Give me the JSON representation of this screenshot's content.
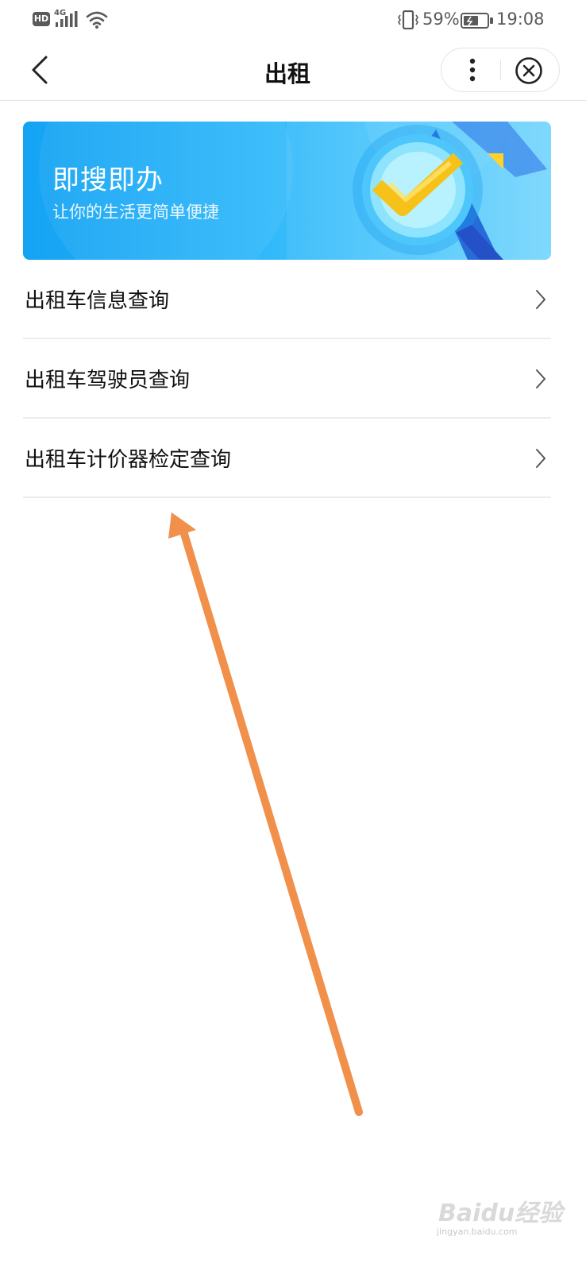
{
  "status_bar": {
    "hd_badge": "HD",
    "network": "4G",
    "battery_percent": "59%",
    "time": "19:08",
    "icons": [
      "signal-icon",
      "wifi-icon",
      "vibrate-icon",
      "battery-icon"
    ]
  },
  "title_bar": {
    "title": "出租",
    "icons": [
      "back-icon",
      "more-icon",
      "close-icon"
    ]
  },
  "banner": {
    "title": "即搜即办",
    "subtitle": "让你的生活更简单便捷",
    "icon": "search-check-icon"
  },
  "menu": {
    "items": [
      {
        "label": "出租车信息查询"
      },
      {
        "label": "出租车驾驶员查询"
      },
      {
        "label": "出租车计价器检定查询"
      }
    ]
  },
  "annotation": {
    "arrow_color": "#f0904a"
  },
  "watermark": {
    "logo": "Baidu经验",
    "url": "jingyan.baidu.com"
  },
  "colors": {
    "banner_blue": "#1aa8f4",
    "divider": "#ececec",
    "text": "#111111",
    "status_text": "#5a5a5a"
  }
}
